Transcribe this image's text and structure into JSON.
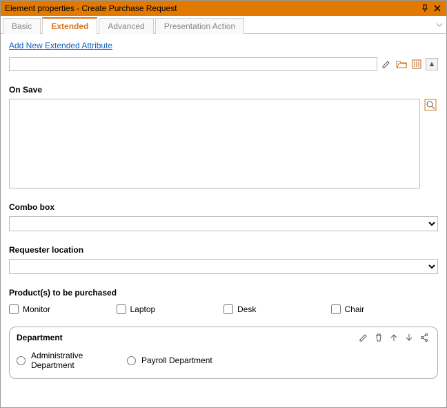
{
  "window": {
    "title": "Element properties - Create Purchase Request"
  },
  "tabs": {
    "basic": "Basic",
    "extended": "Extended",
    "advanced": "Advanced",
    "presentation": "Presentation Action"
  },
  "link": {
    "add_new": "Add New Extended Attribute"
  },
  "sections": {
    "on_save": "On Save",
    "combo": "Combo box",
    "requester": "Requester location",
    "products": "Product(s) to be purchased",
    "department": "Department"
  },
  "products": {
    "monitor": "Monitor",
    "laptop": "Laptop",
    "desk": "Desk",
    "chair": "Chair"
  },
  "dept": {
    "admin": "Administrative Department",
    "payroll": "Payroll Department"
  },
  "fields": {
    "thin_value": "",
    "onsave_value": "",
    "combo_value": "",
    "requester_value": ""
  }
}
